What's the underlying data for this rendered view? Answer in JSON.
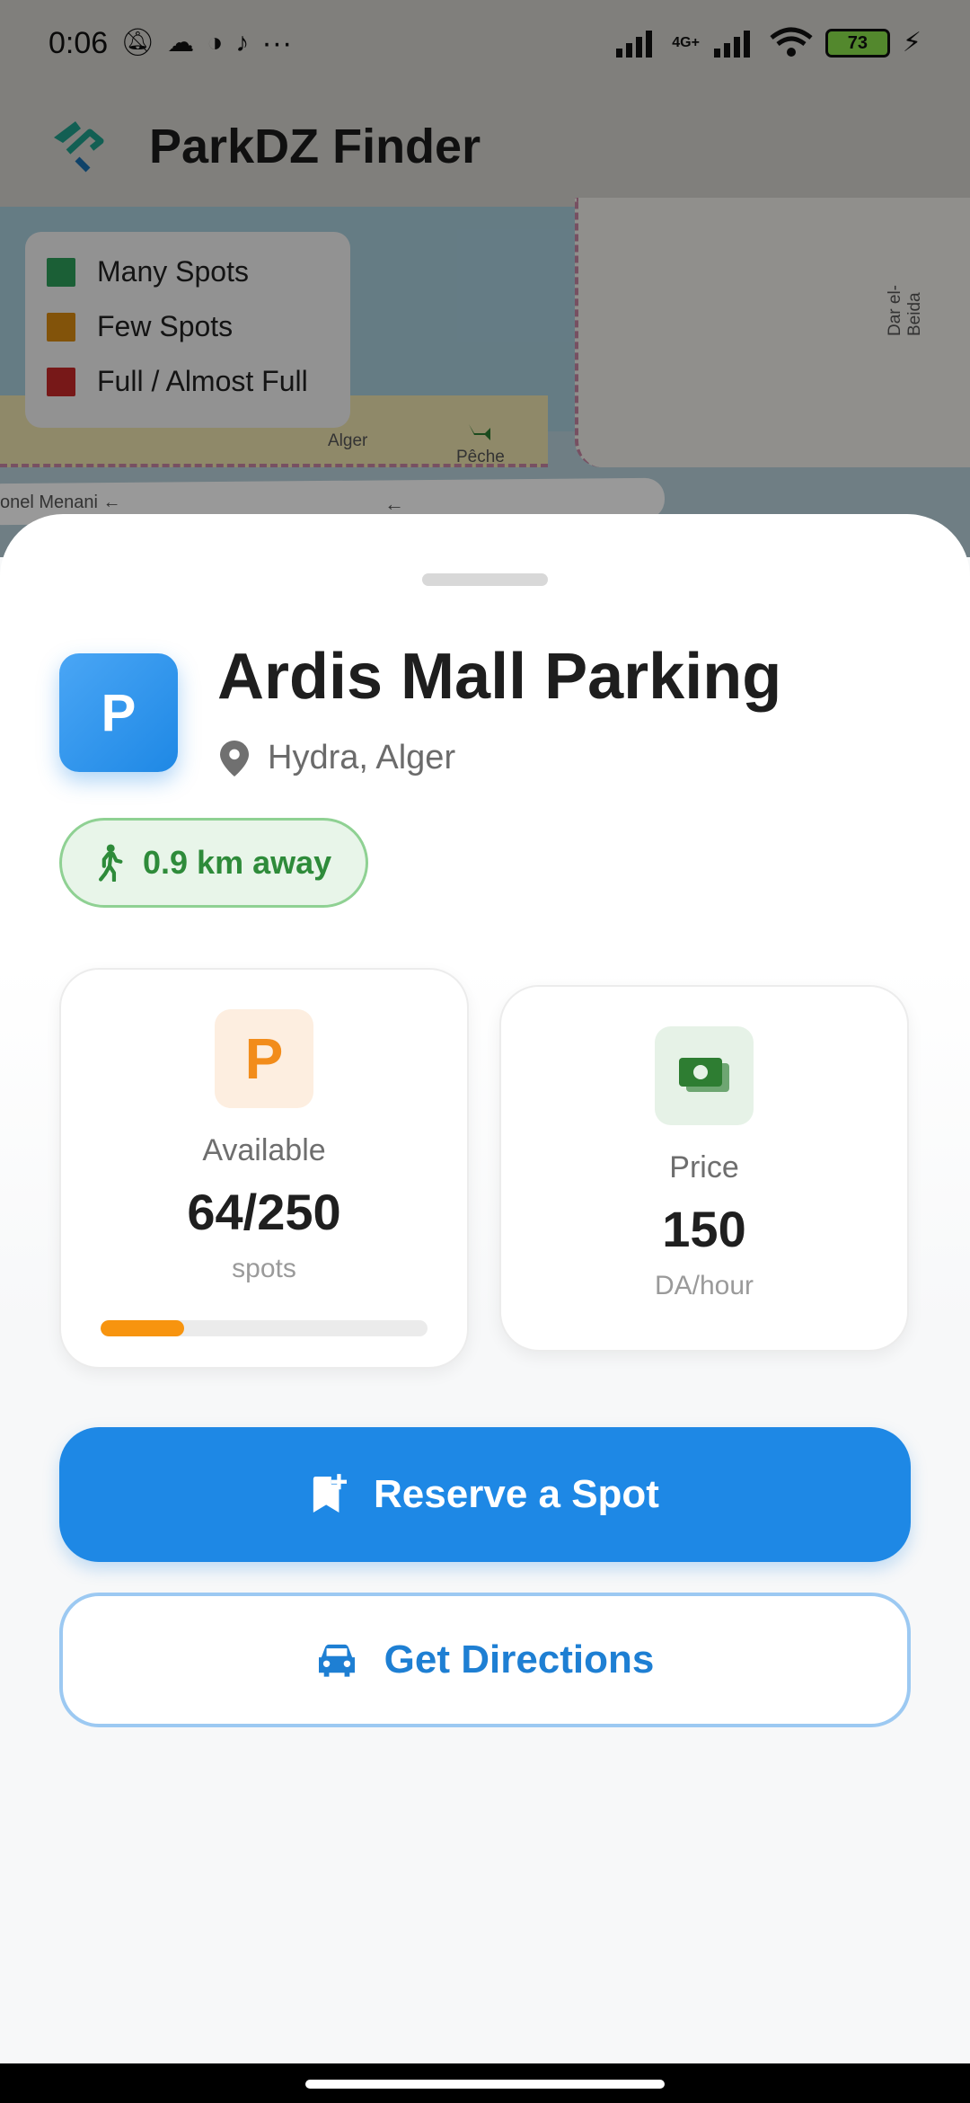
{
  "status_bar": {
    "time": "0:06",
    "more": "···",
    "network": "4G+",
    "battery": "73"
  },
  "app_bar": {
    "title": "ParkDZ Finder"
  },
  "map": {
    "labels": [
      "Dar el-Beida",
      "Alger",
      "Pêche",
      "onel Menani ←",
      "←"
    ],
    "legend": [
      {
        "label": "Many Spots",
        "color": "#2e9e5b"
      },
      {
        "label": "Few Spots",
        "color": "#d98a12"
      },
      {
        "label": "Full / Almost Full",
        "color": "#c62828"
      }
    ]
  },
  "sheet": {
    "lot_icon_letter": "P",
    "name": "Ardis Mall Parking",
    "location": "Hydra, Alger",
    "distance": "0.9 km away",
    "available": {
      "icon_letter": "P",
      "label": "Available",
      "value": "64/250",
      "unit": "spots",
      "fill_fraction": 0.256
    },
    "price": {
      "label": "Price",
      "value": "150",
      "unit": "DA/hour"
    },
    "reserve_button": "Reserve a Spot",
    "directions_button": "Get Directions"
  },
  "colors": {
    "primary": "#1e88e5",
    "available_accent": "#f7940f",
    "distance_green": "#2e8b3a"
  }
}
